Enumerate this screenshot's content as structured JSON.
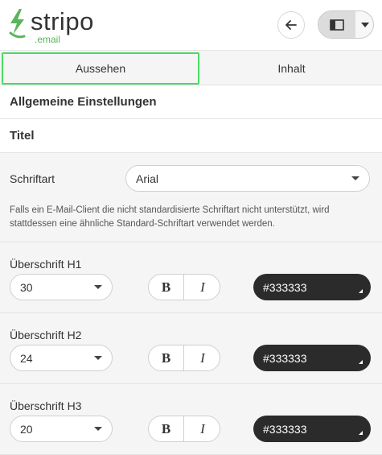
{
  "header": {
    "logo_word": "stripo",
    "logo_sub": ".email",
    "brand_color": "#5ab45a",
    "back_icon": "arrow-left-icon",
    "layout_icon": "layout-panel-icon"
  },
  "tabs": [
    {
      "label": "Aussehen",
      "active": true
    },
    {
      "label": "Inhalt",
      "active": false
    }
  ],
  "sections": {
    "general": "Allgemeine Einstellungen",
    "title": "Titel"
  },
  "font": {
    "label": "Schriftart",
    "value": "Arial",
    "note": "Falls ein E-Mail-Client die nicht standardisierte Schriftart nicht unterstützt, wird stattdessen eine ähnliche Standard-Schriftart verwendet werden."
  },
  "headings": [
    {
      "label": "Überschrift H1",
      "size": "30",
      "bold": "B",
      "italic": "I",
      "color": "#333333"
    },
    {
      "label": "Überschrift H2",
      "size": "24",
      "bold": "B",
      "italic": "I",
      "color": "#333333"
    },
    {
      "label": "Überschrift H3",
      "size": "20",
      "bold": "B",
      "italic": "I",
      "color": "#333333"
    }
  ],
  "colors": {
    "active_tab_border": "#4cd964",
    "picker_bg": "#2b2b2b"
  }
}
